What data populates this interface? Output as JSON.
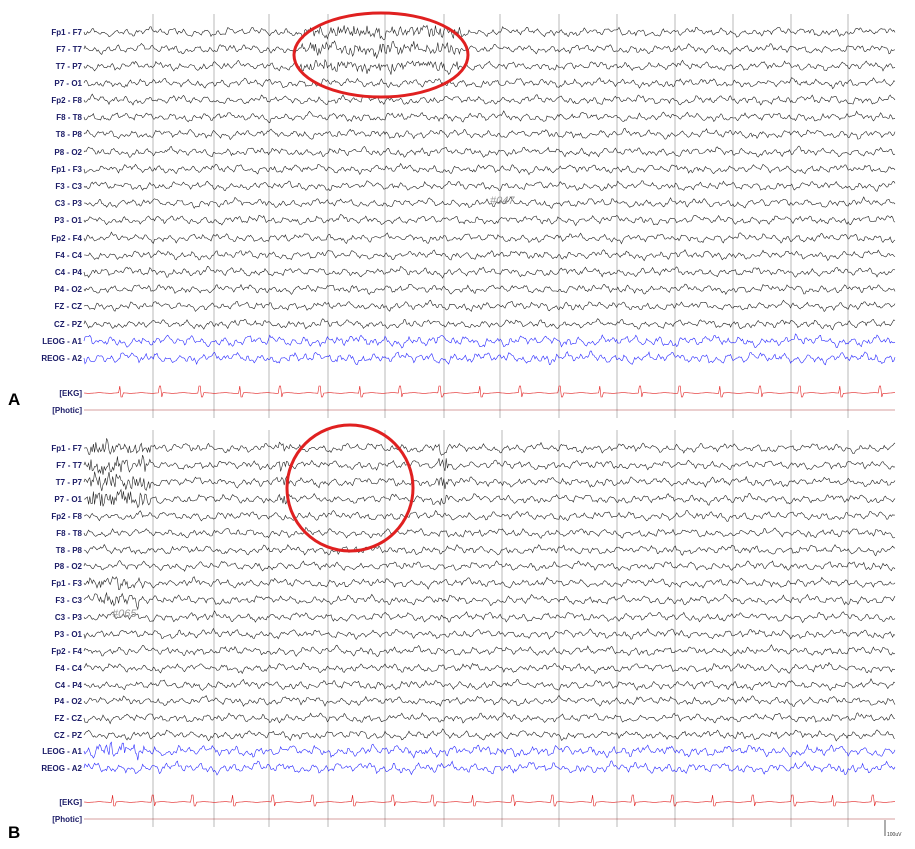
{
  "panels": [
    {
      "letter": "A",
      "stamp": "#047",
      "channels": [
        "Fp1 - F7",
        "F7 - T7",
        "T7 - P7",
        "P7 - O1",
        "Fp2 - F8",
        "F8 - T8",
        "T8 - P8",
        "P8 - O2",
        "Fp1 - F3",
        "F3 - C3",
        "C3 - P3",
        "P3 - O1",
        "Fp2 - F4",
        "F4 - C4",
        "C4 - P4",
        "P4 - O2",
        "FZ - CZ",
        "CZ - PZ",
        "LEOG - A1",
        "REOG - A2",
        "[EKG]",
        "[Photic]"
      ]
    },
    {
      "letter": "B",
      "stamp": "#065",
      "channels": [
        "Fp1 - F7",
        "F7 - T7",
        "T7 - P7",
        "P7 - O1",
        "Fp2 - F8",
        "F8 - T8",
        "T8 - P8",
        "P8 - O2",
        "Fp1 - F3",
        "F3 - C3",
        "C3 - P3",
        "P3 - O1",
        "Fp2 - F4",
        "F4 - C4",
        "C4 - P4",
        "P4 - O2",
        "FZ - CZ",
        "CZ - PZ",
        "LEOG - A1",
        "REOG - A2",
        "[EKG]",
        "[Photic]"
      ]
    }
  ],
  "scale_label": "100uV",
  "colors": {
    "eeg": "#222222",
    "eog": "#2a2aff",
    "ekg": "#e02020",
    "photic": "#b04040",
    "grid": "#9a9a9a",
    "highlight": "#e02020"
  }
}
